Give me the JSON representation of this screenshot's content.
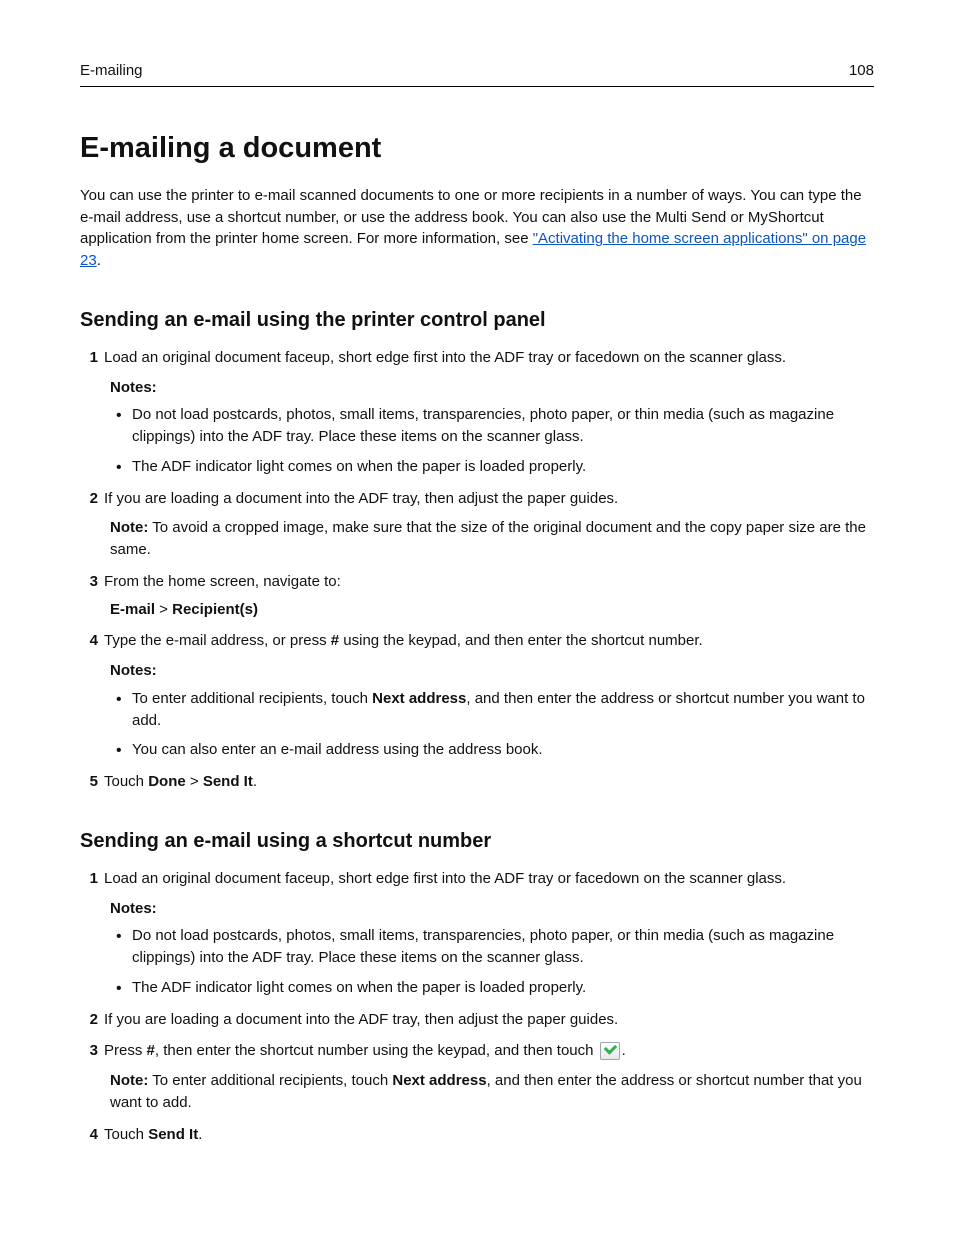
{
  "header": {
    "section": "E-mailing",
    "page_number": "108"
  },
  "title": "E-mailing a document",
  "intro": {
    "text_before_link": "You can use the printer to e-mail scanned documents to one or more recipients in a number of ways. You can type the e-mail address, use a shortcut number, or use the address book. You can also use the Multi Send or MyShortcut application from the printer home screen. For more information, see ",
    "link_text": "\"Activating the home screen applications\" on page 23",
    "text_after_link": "."
  },
  "section_a": {
    "heading": "Sending an e-mail using the printer control panel",
    "step1": {
      "text": "Load an original document faceup, short edge first into the ADF tray or facedown on the scanner glass.",
      "notes_label": "Notes:",
      "bullet1": "Do not load postcards, photos, small items, transparencies, photo paper, or thin media (such as magazine clippings) into the ADF tray. Place these items on the scanner glass.",
      "bullet2": "The ADF indicator light comes on when the paper is loaded properly."
    },
    "step2": {
      "text": "If you are loading a document into the ADF tray, then adjust the paper guides.",
      "note_bold": "Note:",
      "note_rest": " To avoid a cropped image, make sure that the size of the original document and the copy paper size are the same."
    },
    "step3": {
      "text": "From the home screen, navigate to:",
      "nav_a": "E-mail",
      "nav_sep": " > ",
      "nav_b": "Recipient(s)"
    },
    "step4": {
      "pre": "Type the e-mail address, or press ",
      "hash": "#",
      "post": " using the keypad, and then enter the shortcut number.",
      "notes_label": "Notes:",
      "bullet1a": "To enter additional recipients, touch ",
      "bullet1b": "Next address",
      "bullet1c": ", and then enter the address or shortcut number you want to add.",
      "bullet2": "You can also enter an e-mail address using the address book."
    },
    "step5": {
      "pre": "Touch ",
      "a": "Done",
      "sep": " > ",
      "b": "Send It",
      "post": "."
    }
  },
  "section_b": {
    "heading": "Sending an e-mail using a shortcut number",
    "step1": {
      "text": "Load an original document faceup, short edge first into the ADF tray or facedown on the scanner glass.",
      "notes_label": "Notes:",
      "bullet1": "Do not load postcards, photos, small items, transparencies, photo paper, or thin media (such as magazine clippings) into the ADF tray. Place these items on the scanner glass.",
      "bullet2": "The ADF indicator light comes on when the paper is loaded properly."
    },
    "step2": "If you are loading a document into the ADF tray, then adjust the paper guides.",
    "step3": {
      "pre": "Press ",
      "hash": "#",
      "mid": ", then enter the shortcut number using the keypad, and then touch ",
      "post": ".",
      "note_bold": "Note:",
      "note_mid_a": " To enter additional recipients, touch ",
      "note_b": "Next address",
      "note_mid_c": ", and then enter the address or shortcut number that you want to add."
    },
    "step4": {
      "pre": "Touch ",
      "a": "Send It",
      "post": "."
    }
  }
}
